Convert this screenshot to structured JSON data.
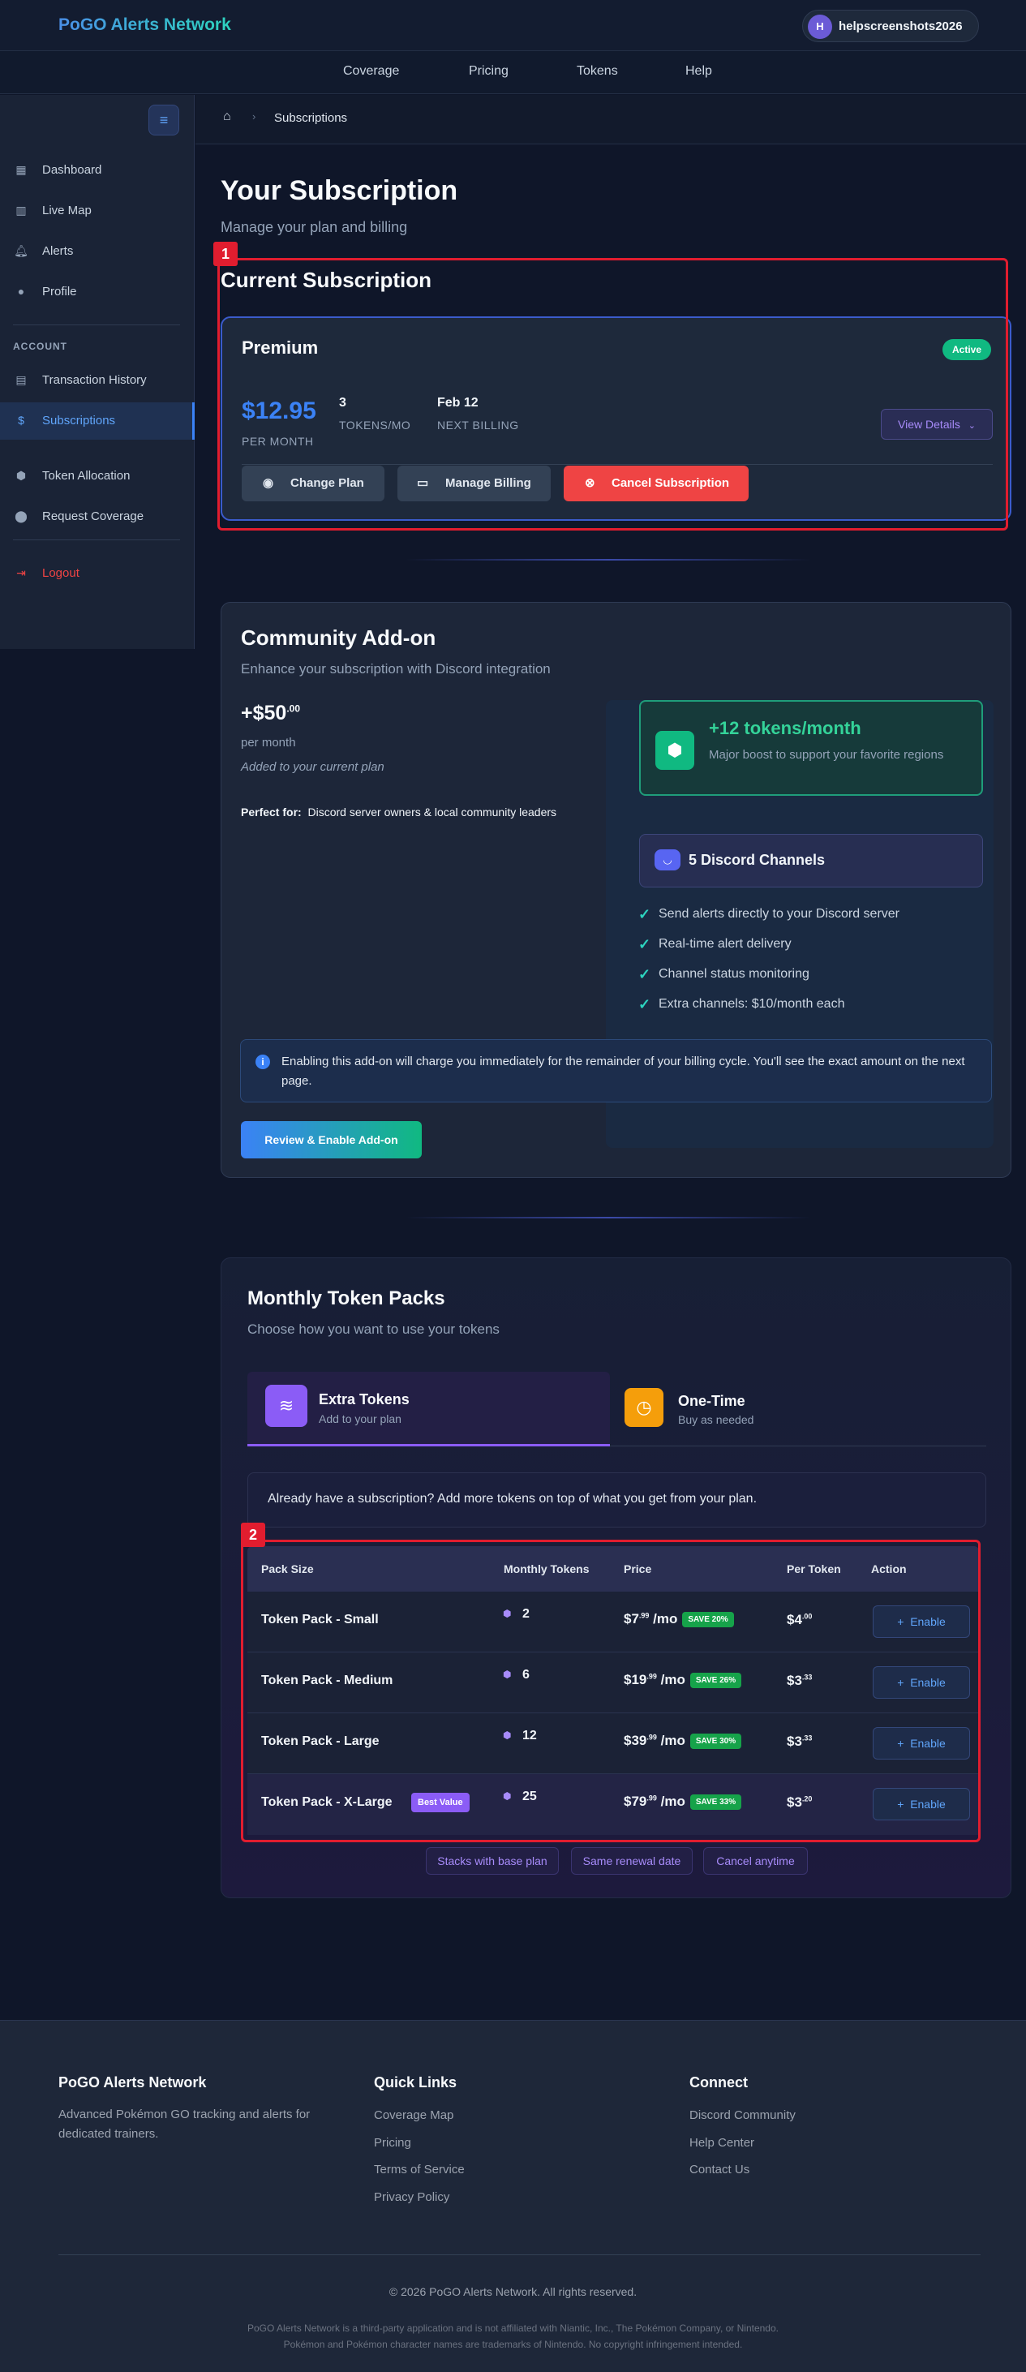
{
  "header": {
    "brand": "PoGO Alerts Network",
    "user_initial": "H",
    "username": "helpscreenshots2026"
  },
  "nav": [
    "Coverage",
    "Pricing",
    "Tokens",
    "Help"
  ],
  "sidebar": {
    "items": [
      {
        "label": "Dashboard",
        "icon": "dashboard-icon"
      },
      {
        "label": "Live Map",
        "icon": "map-icon"
      },
      {
        "label": "Alerts",
        "icon": "bell-icon"
      },
      {
        "label": "Profile",
        "icon": "user-icon"
      }
    ],
    "section_label": "ACCOUNT",
    "account_items": [
      {
        "label": "Transaction History",
        "icon": "receipt-icon"
      },
      {
        "label": "Subscriptions",
        "icon": "dollar-icon"
      },
      {
        "label": "Token Allocation",
        "icon": "shield-icon"
      },
      {
        "label": "Request Coverage",
        "icon": "map-pin-icon"
      }
    ],
    "logout": "Logout"
  },
  "breadcrumb": {
    "current": "Subscriptions"
  },
  "page": {
    "title": "Your Subscription",
    "subtitle": "Manage your plan and billing"
  },
  "current_subscription": {
    "heading": "Current Subscription",
    "plan": "Premium",
    "status": "Active",
    "price": "$12.95",
    "price_caption": "PER MONTH",
    "tokens_value": "3",
    "tokens_caption": "TOKENS/MO",
    "next_billing_value": "Feb 12",
    "next_billing_caption": "NEXT BILLING",
    "view_details": "View Details",
    "change_plan": "Change Plan",
    "manage_billing": "Manage Billing",
    "cancel_subscription": "Cancel Subscription"
  },
  "addon": {
    "title": "Community Add-on",
    "subtitle": "Enhance your subscription with Discord integration",
    "price_main": "+$50",
    "price_cents": ".00",
    "per": "per month",
    "added_note": "Added to your current plan",
    "perfect_for_label": "Perfect for:",
    "perfect_for_text": "Discord server owners & local community leaders",
    "boost_title": "+12 tokens/month",
    "boost_desc": "Major boost to support your favorite regions",
    "channels_title": "5 Discord Channels",
    "features": [
      "Send alerts directly to your Discord server",
      "Real-time alert delivery",
      "Channel status monitoring",
      "Extra channels: $10/month each"
    ],
    "notice": "Enabling this add-on will charge you immediately for the remainder of your billing cycle. You'll see the exact amount on the next page.",
    "cta": "Review & Enable Add-on"
  },
  "token_packs": {
    "title": "Monthly Token Packs",
    "subtitle": "Choose how you want to use your tokens",
    "tab_extra_title": "Extra Tokens",
    "tab_extra_sub": "Add to your plan",
    "tab_onetime_title": "One-Time",
    "tab_onetime_sub": "Buy as needed",
    "info": "Already have a subscription? Add more tokens on top of what you get from your plan.",
    "columns": [
      "Pack Size",
      "Monthly Tokens",
      "Price",
      "Per Token",
      "Action"
    ],
    "rows": [
      {
        "name": "Token Pack - Small",
        "tokens": "2",
        "price": "$7",
        "cents": ".99",
        "per": " /mo",
        "save": "SAVE 20%",
        "per_token": "$4",
        "per_token_cents": ".00",
        "action": "Enable"
      },
      {
        "name": "Token Pack - Medium",
        "tokens": "6",
        "price": "$19",
        "cents": ".99",
        "per": " /mo",
        "save": "SAVE 26%",
        "per_token": "$3",
        "per_token_cents": ".33",
        "action": "Enable"
      },
      {
        "name": "Token Pack - Large",
        "tokens": "12",
        "price": "$39",
        "cents": ".99",
        "per": " /mo",
        "save": "SAVE 30%",
        "per_token": "$3",
        "per_token_cents": ".33",
        "action": "Enable"
      },
      {
        "name": "Token Pack - X-Large",
        "badge": "Best Value",
        "tokens": "25",
        "price": "$79",
        "cents": ".99",
        "per": " /mo",
        "save": "SAVE 33%",
        "per_token": "$3",
        "per_token_cents": ".20",
        "action": "Enable"
      }
    ],
    "pills": [
      "Stacks with base plan",
      "Same renewal date",
      "Cancel anytime"
    ]
  },
  "annotations": [
    "1",
    "2"
  ],
  "footer": {
    "brand": "PoGO Alerts Network",
    "about": "Advanced Pokémon GO tracking and alerts for dedicated trainers.",
    "quick_links_title": "Quick Links",
    "quick_links": [
      "Coverage Map",
      "Pricing",
      "Terms of Service",
      "Privacy Policy"
    ],
    "connect_title": "Connect",
    "connect_links": [
      "Discord Community",
      "Help Center",
      "Contact Us"
    ],
    "copyright": "© 2026 PoGO Alerts Network. All rights reserved.",
    "disclaimer_1": "PoGO Alerts Network is a third-party application and is not affiliated with Niantic, Inc., The Pokémon Company, or Nintendo.",
    "disclaimer_2": "Pokémon and Pokémon character names are trademarks of Nintendo. No copyright infringement intended."
  },
  "colors": {
    "accent": "#3b82f6",
    "success": "#10b981",
    "danger": "#ef4444",
    "purple": "#8b5cf6",
    "orange": "#f59e0b"
  }
}
